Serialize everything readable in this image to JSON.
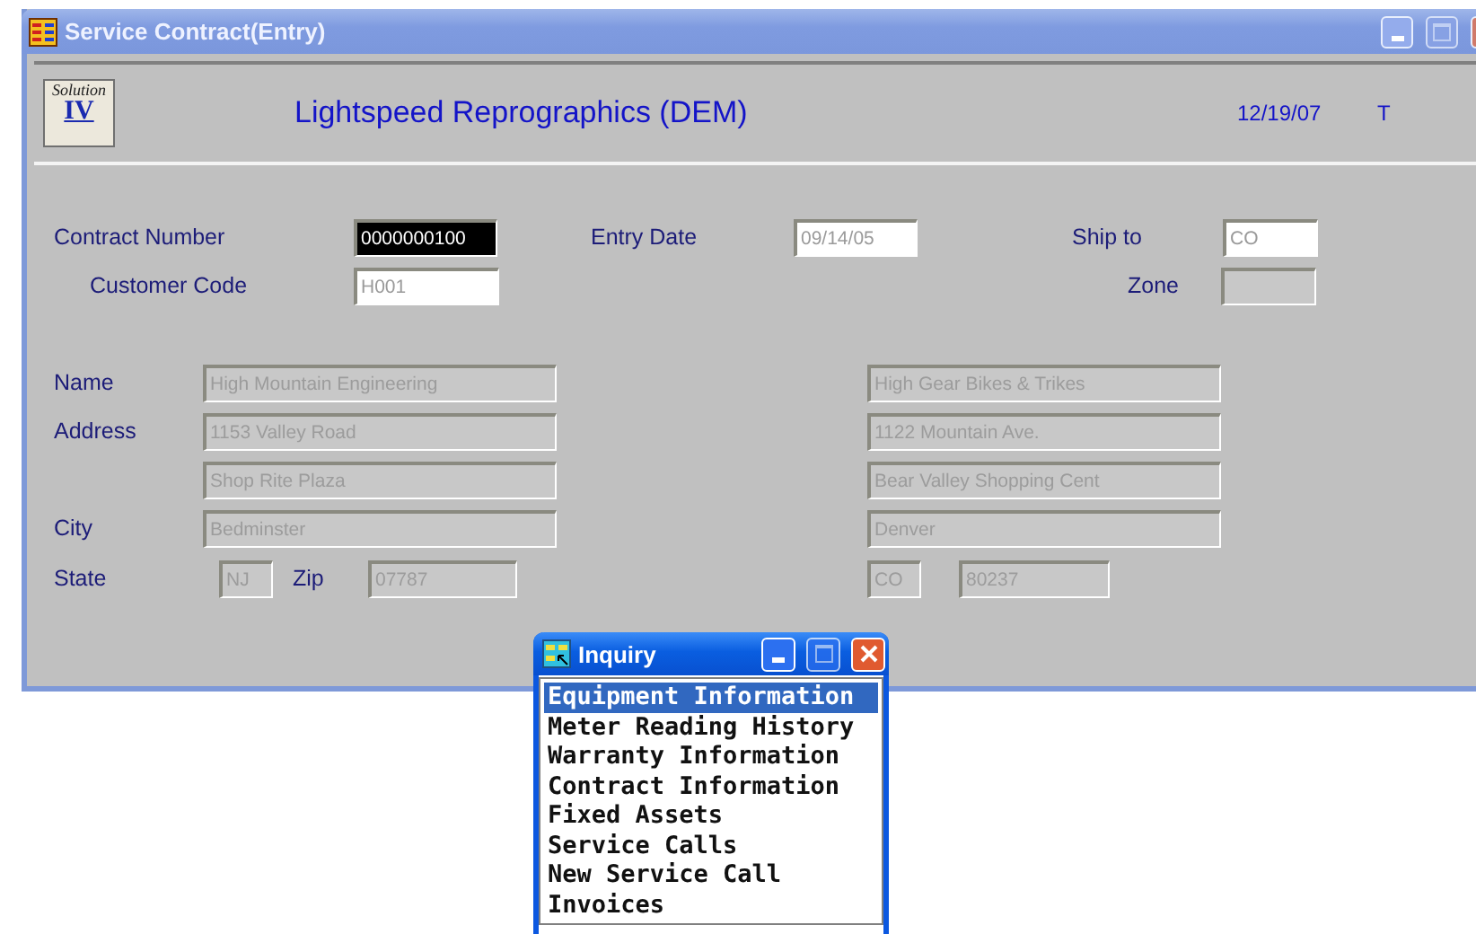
{
  "window": {
    "title": "Service Contract(Entry)"
  },
  "header": {
    "logo_text": "Solution",
    "logo_numeral": "IV",
    "company": "Lightspeed Reprographics (DEM)",
    "date": "12/19/07",
    "cut_text": "T"
  },
  "top_fields": [
    {
      "label": "Contract Number",
      "value": "0000000100",
      "focused": true,
      "disabled": false
    },
    {
      "label": "Entry Date",
      "value": "09/14/05",
      "focused": false,
      "disabled": false
    },
    {
      "label": "Ship to",
      "value": "CO",
      "focused": false,
      "disabled": false
    },
    {
      "label": "Customer Code",
      "value": "H001",
      "focused": false,
      "disabled": false
    },
    {
      "label": "Zone",
      "focused": false,
      "disabled": true
    }
  ],
  "address_labels": {
    "name": "Name",
    "address": "Address",
    "city": "City",
    "state": "State",
    "zip": "Zip"
  },
  "bill_to": {
    "name": "High Mountain Engineering",
    "address_1": "1153 Valley Road",
    "address_2": "Shop Rite Plaza",
    "city": "Bedminster",
    "state": "NJ",
    "zip": "07787"
  },
  "ship_to_address": {
    "name": "High Gear Bikes & Trikes",
    "address_1": "1122 Mountain Ave.",
    "address_2": "Bear Valley Shopping Cent",
    "city": "Denver",
    "state": "CO",
    "zip": "80237"
  },
  "inquiry": {
    "title": "Inquiry",
    "items": [
      {
        "label": "Equipment Information",
        "selected": true
      },
      {
        "label": "Meter Reading History",
        "selected": false
      },
      {
        "label": "Warranty Information",
        "selected": false
      },
      {
        "label": "Contract Information",
        "selected": false
      },
      {
        "label": "Fixed Assets",
        "selected": false
      },
      {
        "label": "Service Calls",
        "selected": false
      },
      {
        "label": "New Service Call",
        "selected": false
      },
      {
        "label": "Invoices",
        "selected": false
      }
    ]
  }
}
